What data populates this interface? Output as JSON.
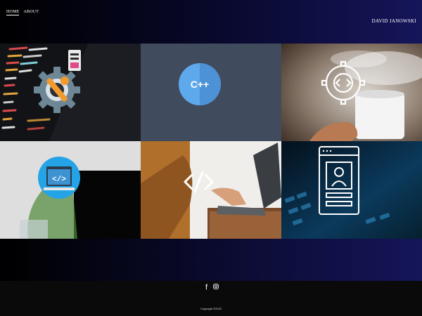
{
  "nav": {
    "items": [
      {
        "label": "HOME",
        "active": true
      },
      {
        "label": "ABOUT",
        "active": false
      }
    ]
  },
  "brand": {
    "name": "DAVID JANOWSKI"
  },
  "gallery": {
    "tiles": [
      {
        "icon": "gear-wrench-icon",
        "text": ""
      },
      {
        "icon": "cpp-logo-icon",
        "text": "C++"
      },
      {
        "icon": "gear-code-icon",
        "text": ""
      },
      {
        "icon": "code-window-icon",
        "text": ""
      },
      {
        "icon": "code-brackets-icon",
        "text": ""
      },
      {
        "icon": "profile-window-icon",
        "text": ""
      }
    ]
  },
  "social": [
    {
      "icon": "facebook-icon",
      "label": "f"
    },
    {
      "icon": "instagram-icon"
    }
  ],
  "footer": {
    "copyright": "Copyright ©2022"
  },
  "colors": {
    "header_end": "#15155a",
    "tile_slate": "#414b5e",
    "cpp_blue": "#5ea8ec"
  }
}
